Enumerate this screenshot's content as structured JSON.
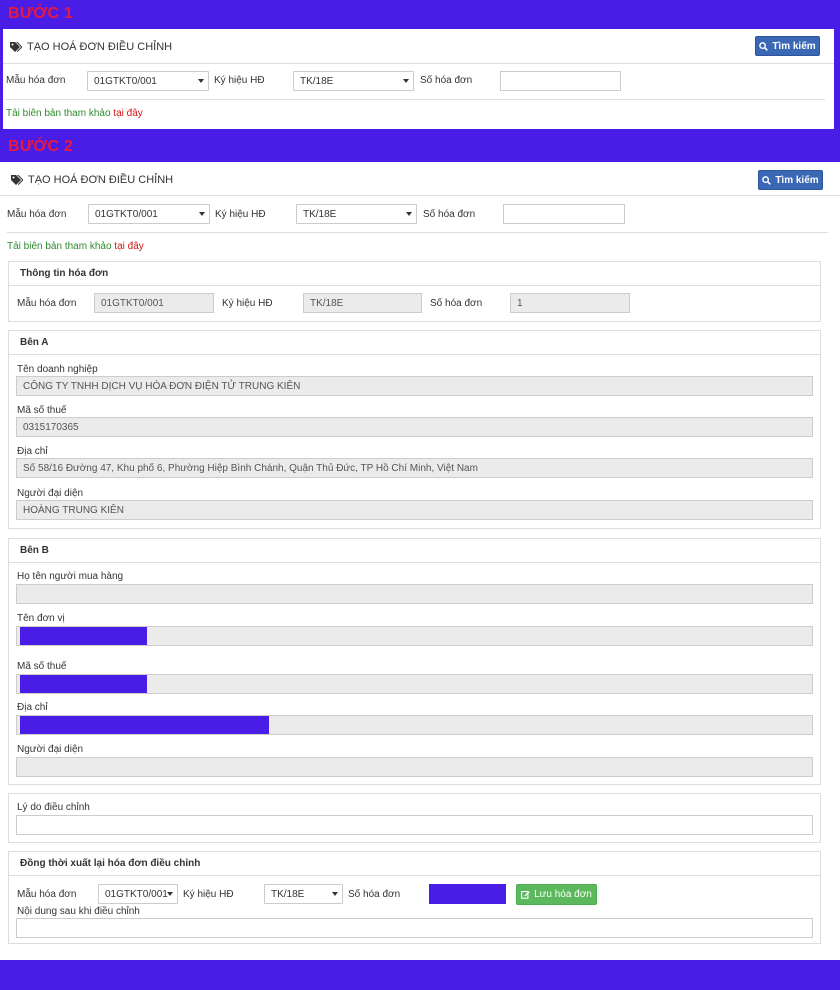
{
  "step1": {
    "title": "BƯỚC 1",
    "header": "TẠO HOÁ ĐƠN ĐIỀU CHỈNH",
    "search_button": "Tìm kiếm",
    "mau_label": "Mẫu hóa đơn",
    "mau_value": "01GTKT0/001",
    "kyhieu_label": "Ký hiệu HĐ",
    "kyhieu_value": "TK/18E",
    "so_label": "Số hóa đơn",
    "so_value": "",
    "download_text": "Tải biên bản tham khảo",
    "download_link": "tại đây"
  },
  "step2": {
    "title": "BƯỚC 2",
    "header": "TẠO HOÁ ĐƠN ĐIỀU CHỈNH",
    "search_button": "Tìm kiếm",
    "mau_label": "Mẫu hóa đơn",
    "mau_value": "01GTKT0/001",
    "kyhieu_label": "Ký hiệu HĐ",
    "kyhieu_value": "TK/18E",
    "so_label": "Số hóa đơn",
    "so_value": "",
    "download_text": "Tải biên bản tham khảo",
    "download_link": "tại đây",
    "invoice_info": {
      "title": "Thông tin hóa đơn",
      "mau_label": "Mẫu hóa đơn",
      "mau_value": "01GTKT0/001",
      "kyhieu_label": "Ký hiệu HĐ",
      "kyhieu_value": "TK/18E",
      "so_label": "Số hóa đơn",
      "so_value": "1"
    },
    "ben_a": {
      "title": "Bên A",
      "company_label": "Tên doanh nghiệp",
      "company_value": "CÔNG TY TNHH DỊCH VỤ HÓA ĐƠN ĐIỆN TỬ TRUNG KIÊN",
      "tax_label": "Mã số thuế",
      "tax_value": "0315170365",
      "address_label": "Địa chỉ",
      "address_value": "Số 58/16 Đường 47, Khu phố 6, Phường Hiệp Bình Chánh, Quận Thủ Đức, TP Hồ Chí Minh, Việt Nam",
      "rep_label": "Người đại diện",
      "rep_value": "HOÀNG TRUNG KIÊN"
    },
    "ben_b": {
      "title": "Bên B",
      "buyer_label": "Họ tên người mua hàng",
      "buyer_value": "",
      "unit_label": "Tên đơn vị",
      "tax_label": "Mã số thuế",
      "address_label": "Địa chỉ",
      "rep_label": "Người đại diện",
      "rep_value": ""
    },
    "reason": {
      "label": "Lý do điều chỉnh",
      "value": ""
    },
    "reissue": {
      "title": "Đồng thời xuất lại hóa đơn điều chỉnh",
      "mau_label": "Mẫu hóa đơn",
      "mau_value": "01GTKT0/001",
      "kyhieu_label": "Ký hiệu HĐ",
      "kyhieu_value": "TK/18E",
      "so_label": "Số hóa đơn",
      "save_button": "Lưu hóa đơn",
      "content_label": "Nội dung sau khi điều chỉnh",
      "content_value": ""
    }
  },
  "colors": {
    "background": "#4a1de6",
    "step_title": "#e8193c",
    "search_button": "#3b68b5",
    "save_button": "#5cb85c",
    "link_green": "#2e8b2e",
    "link_red": "#d41616"
  }
}
